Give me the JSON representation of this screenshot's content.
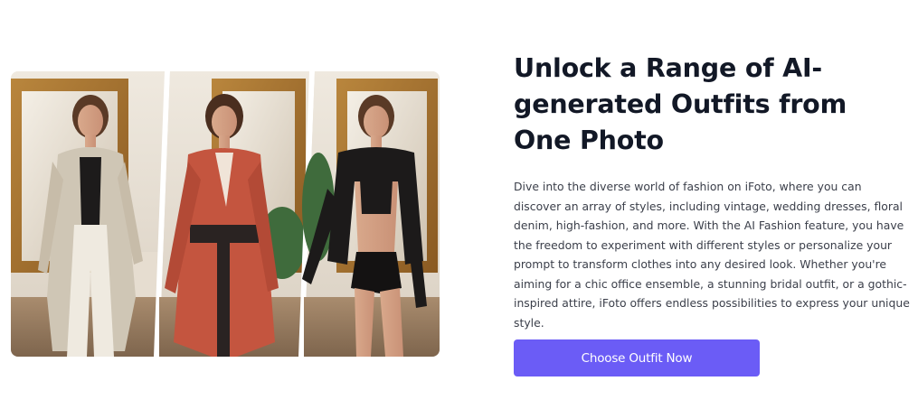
{
  "showcase": {
    "image_alt": "Three AI-generated outfit variations of the same model",
    "panels": [
      {
        "outfit": "beige oversized coat and trousers",
        "garment_color": "#cfc6b5",
        "accent_color": "#efeae0"
      },
      {
        "outfit": "red kimono-style robe with dark sash",
        "garment_color": "#c4553f",
        "accent_color": "#2a2322"
      },
      {
        "outfit": "black leather jacket and leather shorts",
        "garment_color": "#1c1a1a",
        "accent_color": "#d9a98c"
      }
    ]
  },
  "headline": "Unlock a Range of AI-generated Outfits from One Photo",
  "description": "Dive into the diverse world of fashion on iFoto, where you can discover an array of styles, including vintage, wedding dresses, floral denim, high-fashion, and more. With the AI Fashion feature, you have the freedom to experiment with different styles or personalize your prompt to transform clothes into any desired look. Whether you're aiming for a chic office ensemble, a stunning bridal outfit, or a gothic-inspired attire, iFoto offers endless possibilities to express your unique style.",
  "cta": {
    "label": "Choose Outfit Now"
  },
  "colors": {
    "accent": "#6b5cf6",
    "headline": "#121826",
    "body_text": "#3b3f4a"
  }
}
